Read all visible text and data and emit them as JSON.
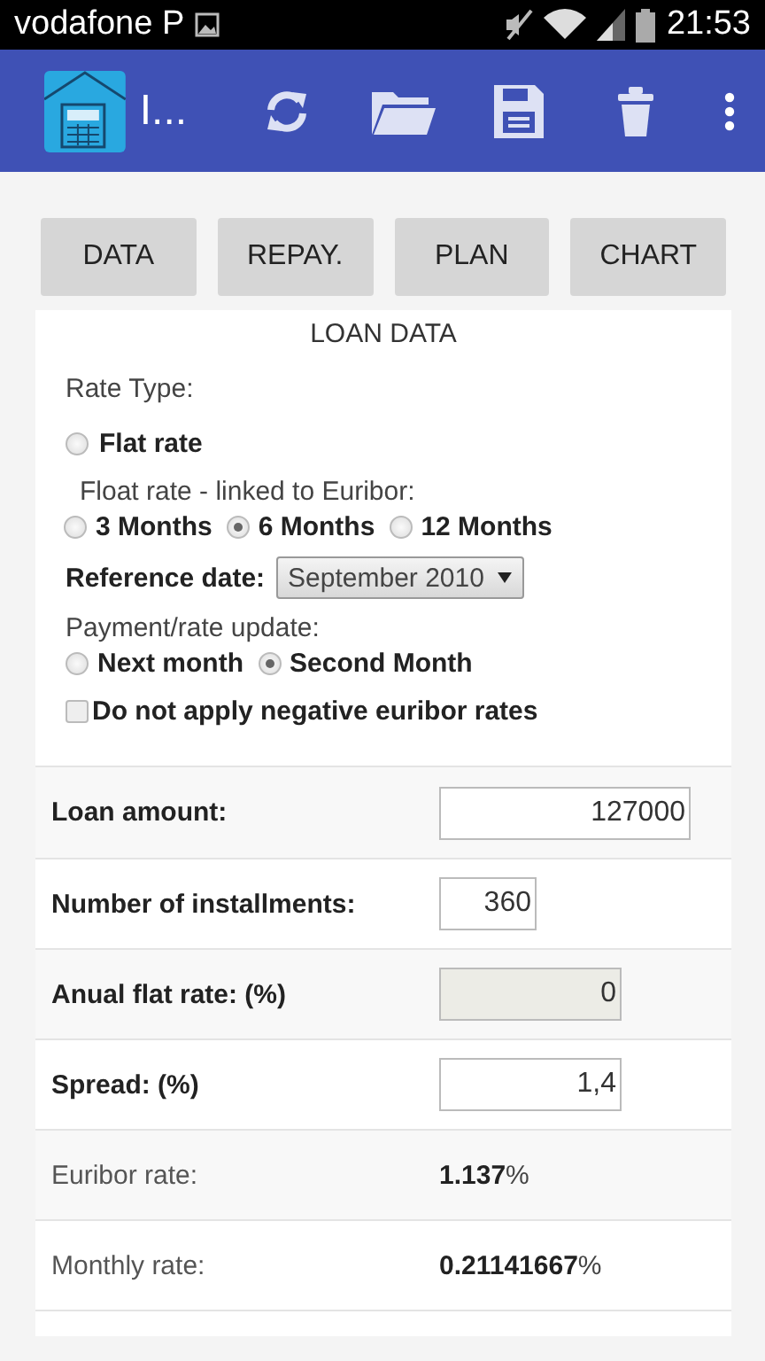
{
  "status_bar": {
    "carrier": "vodafone P",
    "time": "21:53"
  },
  "app_bar": {
    "title": "I..."
  },
  "buttons": [
    {
      "label": "DATA"
    },
    {
      "label": "REPAY."
    },
    {
      "label": "PLAN"
    },
    {
      "label": "CHART"
    }
  ],
  "loan_data": {
    "title": "LOAN DATA",
    "rate_type_label": "Rate Type:",
    "flat_rate": {
      "label": "Flat rate",
      "selected": false
    },
    "float_label": "Float rate - linked to Euribor:",
    "float_options": [
      {
        "label": "3 Months",
        "selected": false
      },
      {
        "label": "6 Months",
        "selected": true
      },
      {
        "label": "12 Months",
        "selected": false
      }
    ],
    "reference_date": {
      "label": "Reference date:",
      "value": "September 2010"
    },
    "update_label": "Payment/rate update:",
    "update_options": [
      {
        "label": "Next month",
        "selected": false
      },
      {
        "label": "Second Month",
        "selected": true
      }
    ],
    "negative_rates": {
      "label": "Do not apply negative euribor rates",
      "checked": false
    }
  },
  "fields": [
    {
      "kind": "input",
      "label": "Loan amount:",
      "value": "127000",
      "disabled": false
    },
    {
      "kind": "input",
      "label": "Number of installments:",
      "value": "360",
      "disabled": false
    },
    {
      "kind": "input",
      "label": "Anual flat rate: (%)",
      "value": "0",
      "disabled": true
    },
    {
      "kind": "input",
      "label": "Spread: (%)",
      "value": "1,4",
      "disabled": false
    },
    {
      "kind": "readout",
      "label": "Euribor rate:",
      "value": "**1.137**%"
    },
    {
      "kind": "readout",
      "label": "Monthly rate:",
      "value": "**0.21141667**%"
    }
  ]
}
